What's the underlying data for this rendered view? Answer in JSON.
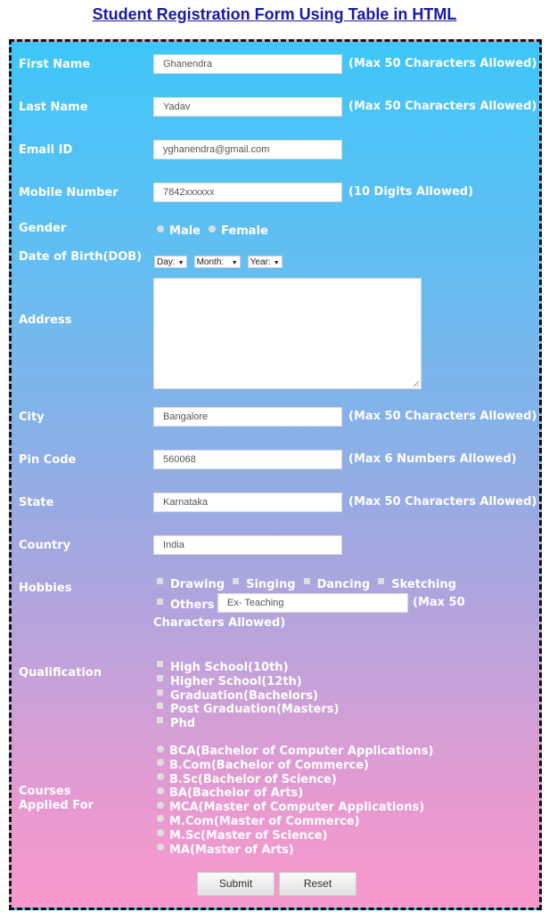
{
  "page_title": "Student Registration Form Using Table in HTML",
  "colors": {
    "gradient_top": "#3ec6f8",
    "gradient_bottom": "#f999cd",
    "title_link": "#1a1aa6",
    "label_text": "#ffffff"
  },
  "fields": {
    "first_name": {
      "label": "First Name",
      "value": "Ghanendra",
      "hint": "(Max 50 Characters Allowed)"
    },
    "last_name": {
      "label": "Last Name",
      "value": "Yadav",
      "hint": "(Max 50 Characters Allowed)"
    },
    "email": {
      "label": "Email ID",
      "value": "yghanendra@gmail.com"
    },
    "mobile": {
      "label": "Mobile Number",
      "value": "7842xxxxxx",
      "hint": "(10 Digits Allowed)"
    },
    "gender": {
      "label": "Gender",
      "options": [
        "Male",
        "Female"
      ]
    },
    "dob": {
      "label": "Date of Birth(DOB)",
      "day": "Day:",
      "month": "Month:",
      "year": "Year:"
    },
    "address": {
      "label": "Address",
      "value": ""
    },
    "city": {
      "label": "City",
      "value": "Bangalore",
      "hint": "(Max 50 Characters Allowed)"
    },
    "pin": {
      "label": "Pin Code",
      "value": "560068",
      "hint": "(Max 6 Numbers Allowed)"
    },
    "state": {
      "label": "State",
      "value": "Karnataka",
      "hint": "(Max 50 Characters Allowed)"
    },
    "country": {
      "label": "Country",
      "value": "India"
    },
    "hobbies": {
      "label": "Hobbies",
      "options": [
        "Drawing",
        "Singing",
        "Dancing",
        "Sketching"
      ],
      "others_label": "Others",
      "others_value": "Ex- Teaching",
      "hint_part1": "(Max 50",
      "hint_part2": "Characters Allowed)"
    },
    "qualification": {
      "label": "Qualification",
      "options": [
        "High School(10th)",
        "Higher School(12th)",
        "Graduation(Bachelors)",
        "Post Graduation(Masters)",
        "Phd"
      ]
    },
    "courses": {
      "label_line1": "Courses",
      "label_line2": "Applied For",
      "options": [
        "BCA(Bachelor of Computer Applications)",
        "B.Com(Bachelor of Commerce)",
        "B.Sc(Bachelor of Science)",
        "BA(Bachelor of Arts)",
        "MCA(Master of Computer Applications)",
        "M.Com(Master of Commerce)",
        "M.Sc(Master of Science)",
        "MA(Master of Arts)"
      ]
    }
  },
  "buttons": {
    "submit": "Submit",
    "reset": "Reset"
  }
}
